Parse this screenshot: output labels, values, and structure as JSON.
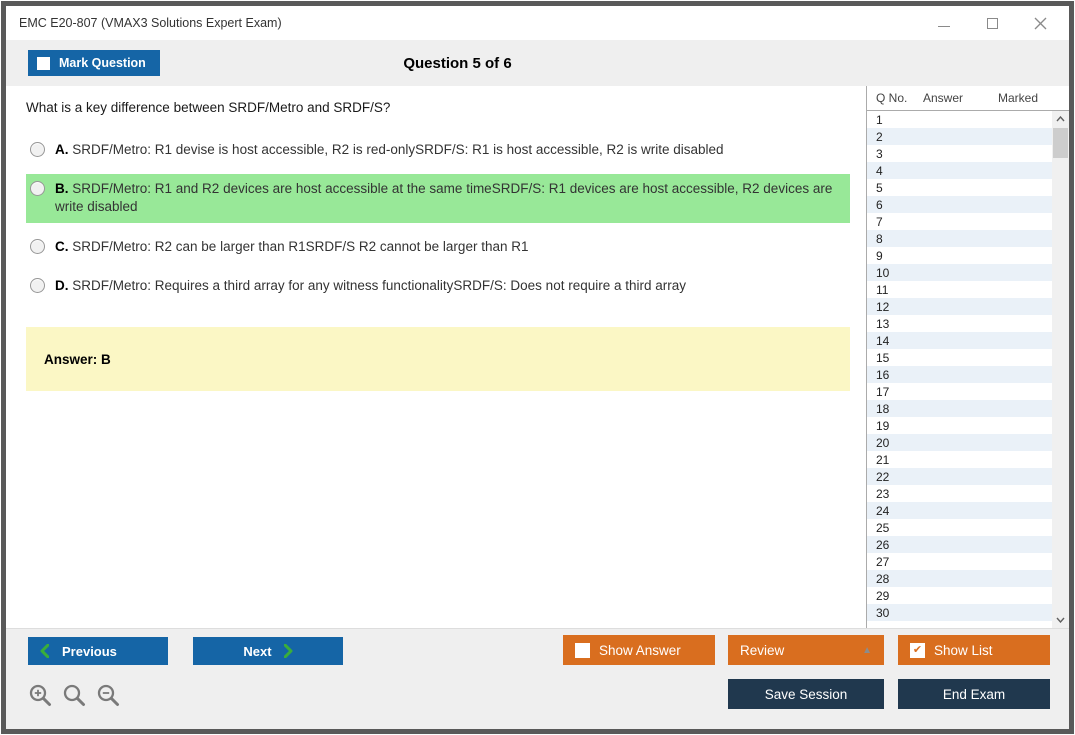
{
  "window": {
    "title": "EMC E20-807 (VMAX3 Solutions Expert Exam)",
    "controls": [
      "minimize",
      "maximize",
      "close"
    ]
  },
  "header": {
    "mark_question_label": "Mark Question",
    "mark_question_checked": false,
    "question_counter": "Question 5 of 6"
  },
  "question": {
    "text": "What is a key difference between SRDF/Metro and SRDF/S?",
    "options": [
      {
        "letter": "A.",
        "text": "SRDF/Metro: R1 devise is host accessible, R2 is red-onlySRDF/S: R1 is host accessible, R2 is write disabled",
        "highlighted": false
      },
      {
        "letter": "B.",
        "text": "SRDF/Metro: R1 and R2 devices are host accessible at the same timeSRDF/S: R1 devices are host accessible, R2 devices are write disabled",
        "highlighted": true
      },
      {
        "letter": "C.",
        "text": "SRDF/Metro: R2 can be larger than R1SRDF/S R2 cannot be larger than R1",
        "highlighted": false
      },
      {
        "letter": "D.",
        "text": "SRDF/Metro: Requires a third array for any witness functionalitySRDF/S: Does not require a third array",
        "highlighted": false
      }
    ],
    "answer_label": "Answer: B"
  },
  "sidebar": {
    "columns": {
      "q_no": "Q No.",
      "answer": "Answer",
      "marked": "Marked"
    },
    "rows": [
      {
        "q_no": "1",
        "answer": "",
        "marked": ""
      },
      {
        "q_no": "2",
        "answer": "",
        "marked": ""
      },
      {
        "q_no": "3",
        "answer": "",
        "marked": ""
      },
      {
        "q_no": "4",
        "answer": "",
        "marked": ""
      },
      {
        "q_no": "5",
        "answer": "",
        "marked": ""
      },
      {
        "q_no": "6",
        "answer": "",
        "marked": ""
      },
      {
        "q_no": "7",
        "answer": "",
        "marked": ""
      },
      {
        "q_no": "8",
        "answer": "",
        "marked": ""
      },
      {
        "q_no": "9",
        "answer": "",
        "marked": ""
      },
      {
        "q_no": "10",
        "answer": "",
        "marked": ""
      },
      {
        "q_no": "11",
        "answer": "",
        "marked": ""
      },
      {
        "q_no": "12",
        "answer": "",
        "marked": ""
      },
      {
        "q_no": "13",
        "answer": "",
        "marked": ""
      },
      {
        "q_no": "14",
        "answer": "",
        "marked": ""
      },
      {
        "q_no": "15",
        "answer": "",
        "marked": ""
      },
      {
        "q_no": "16",
        "answer": "",
        "marked": ""
      },
      {
        "q_no": "17",
        "answer": "",
        "marked": ""
      },
      {
        "q_no": "18",
        "answer": "",
        "marked": ""
      },
      {
        "q_no": "19",
        "answer": "",
        "marked": ""
      },
      {
        "q_no": "20",
        "answer": "",
        "marked": ""
      },
      {
        "q_no": "21",
        "answer": "",
        "marked": ""
      },
      {
        "q_no": "22",
        "answer": "",
        "marked": ""
      },
      {
        "q_no": "23",
        "answer": "",
        "marked": ""
      },
      {
        "q_no": "24",
        "answer": "",
        "marked": ""
      },
      {
        "q_no": "25",
        "answer": "",
        "marked": ""
      },
      {
        "q_no": "26",
        "answer": "",
        "marked": ""
      },
      {
        "q_no": "27",
        "answer": "",
        "marked": ""
      },
      {
        "q_no": "28",
        "answer": "",
        "marked": ""
      },
      {
        "q_no": "29",
        "answer": "",
        "marked": ""
      },
      {
        "q_no": "30",
        "answer": "",
        "marked": ""
      }
    ]
  },
  "footer": {
    "previous_label": "Previous",
    "next_label": "Next",
    "show_answer_label": "Show Answer",
    "show_answer_checked": false,
    "review_label": "Review",
    "show_list_label": "Show List",
    "show_list_checked": true,
    "save_session_label": "Save Session",
    "end_exam_label": "End Exam",
    "zoom_icons": [
      "zoom-in-icon",
      "magnifier-icon",
      "zoom-out-icon"
    ]
  },
  "colors": {
    "accent_blue": "#1565a6",
    "accent_orange": "#d96e1f",
    "accent_navy": "#20384e",
    "highlight_green": "#98e898",
    "answer_yellow": "#fbf7c5",
    "chevron_green": "#3aae3a"
  }
}
